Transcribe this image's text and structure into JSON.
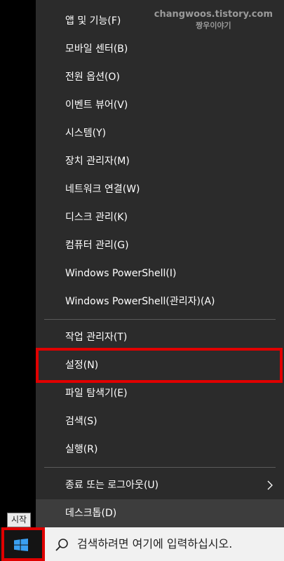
{
  "watermark": {
    "line1": "changwoos.tistory.com",
    "line2": "짱우이야기"
  },
  "menu": {
    "groups": [
      [
        {
          "label": "앱 및 기능(F)"
        },
        {
          "label": "모바일 센터(B)"
        },
        {
          "label": "전원 옵션(O)"
        },
        {
          "label": "이벤트 뷰어(V)"
        },
        {
          "label": "시스템(Y)"
        },
        {
          "label": "장치 관리자(M)"
        },
        {
          "label": "네트워크 연결(W)"
        },
        {
          "label": "디스크 관리(K)"
        },
        {
          "label": "컴퓨터 관리(G)"
        },
        {
          "label": "Windows PowerShell(I)"
        },
        {
          "label": "Windows PowerShell(관리자)(A)"
        }
      ],
      [
        {
          "label": "작업 관리자(T)"
        },
        {
          "label": "설정(N)"
        },
        {
          "label": "파일 탐색기(E)"
        },
        {
          "label": "검색(S)"
        },
        {
          "label": "실행(R)"
        }
      ],
      [
        {
          "label": "종료 또는 로그아웃(U)"
        },
        {
          "label": "데스크톱(D)"
        }
      ]
    ]
  },
  "taskbar": {
    "start_tooltip": "시작",
    "search_placeholder": "검색하려면 여기에 입력하십시오."
  },
  "icons": {
    "start": "windows-logo-icon",
    "search": "magnifier-icon",
    "submenu": "chevron-right-icon"
  },
  "colors": {
    "menu_bg": "#2b2b2b",
    "highlight": "#e00000",
    "windows_blue": "#3a9ff1"
  }
}
